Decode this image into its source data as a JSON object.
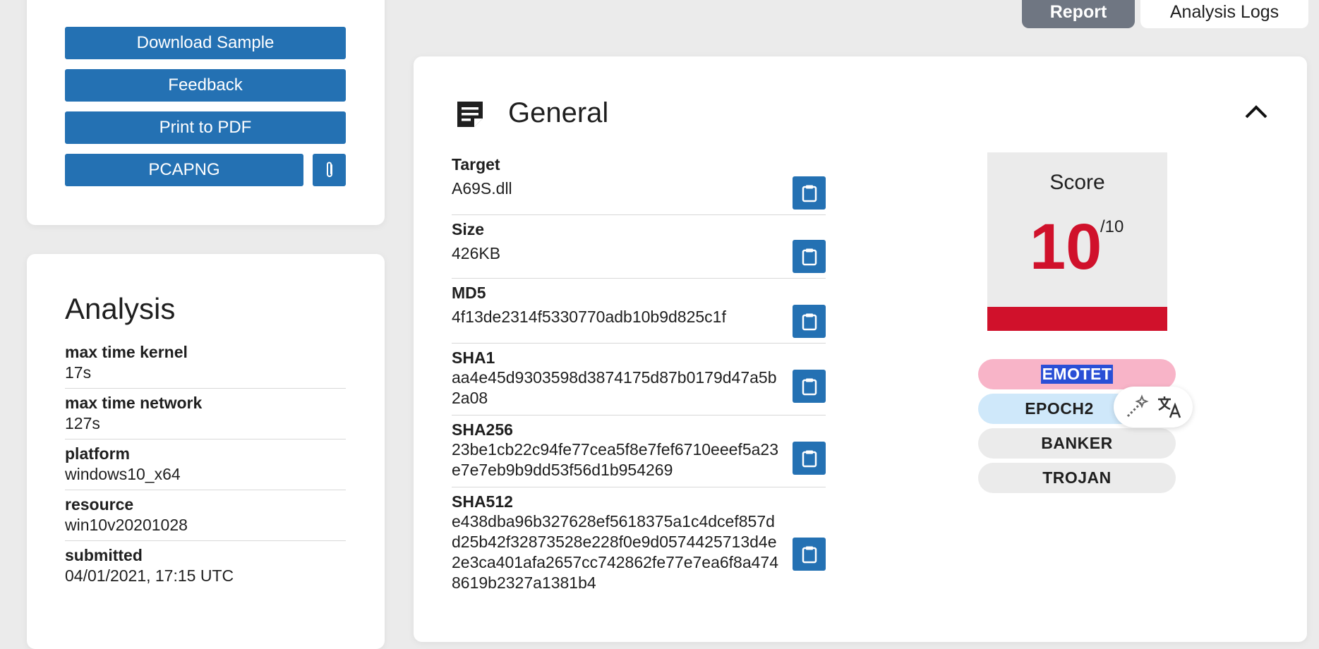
{
  "actions": {
    "download_sample": "Download Sample",
    "feedback": "Feedback",
    "print_pdf": "Print to PDF",
    "pcapng": "PCAPNG"
  },
  "tabs": {
    "report": "Report",
    "analysis_logs": "Analysis Logs"
  },
  "analysis": {
    "title": "Analysis",
    "rows": [
      {
        "key": "max time kernel",
        "value": "17s"
      },
      {
        "key": "max time network",
        "value": "127s"
      },
      {
        "key": "platform",
        "value": "windows10_x64"
      },
      {
        "key": "resource",
        "value": "win10v20201028"
      },
      {
        "key": "submitted",
        "value": "04/01/2021, 17:15 UTC"
      }
    ]
  },
  "general": {
    "title": "General",
    "fields": [
      {
        "key": "Target",
        "value": "A69S.dll"
      },
      {
        "key": "Size",
        "value": "426KB"
      },
      {
        "key": "MD5",
        "value": "4f13de2314f5330770adb10b9d825c1f"
      },
      {
        "key": "SHA1",
        "value": "aa4e45d9303598d3874175d87b0179d47a5b2a08"
      },
      {
        "key": "SHA256",
        "value": "23be1cb22c94fe77cea5f8e7fef6710eeef5a23e7e7eb9b9dd53f56d1b954269"
      },
      {
        "key": "SHA512",
        "value": "e438dba96b327628ef5618375a1c4dcef857dd25b42f32873528e228f0e9d0574425713d4e2e3ca401afa2657cc742862fe77e7ea6f8a4748619b2327a1381b4"
      }
    ]
  },
  "score": {
    "label": "Score",
    "value": "10",
    "max": "/10",
    "color": "#d0112b"
  },
  "tags": [
    "EMOTET",
    "EPOCH2",
    "BANKER",
    "TROJAN"
  ],
  "colors": {
    "primary": "#2471b3",
    "danger": "#d0112b",
    "tab_active": "#6f7682"
  }
}
